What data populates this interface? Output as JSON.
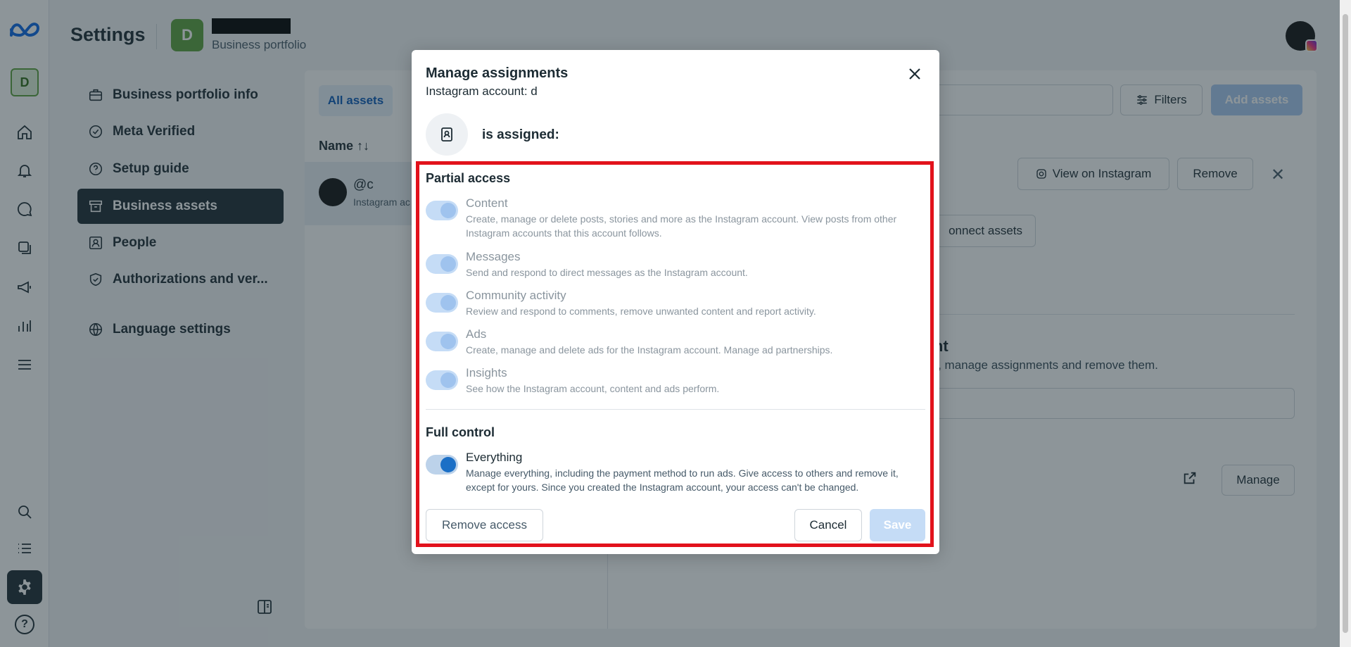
{
  "header": {
    "title": "Settings",
    "account_initial": "D",
    "account_subtitle": "Business portfolio"
  },
  "rail": {
    "account_initial": "D"
  },
  "settings_nav": [
    {
      "label": "Business portfolio info",
      "icon": "briefcase-icon"
    },
    {
      "label": "Meta Verified",
      "icon": "verified-badge-icon"
    },
    {
      "label": "Setup guide",
      "icon": "question-circle-icon"
    },
    {
      "label": "Business assets",
      "icon": "asset-box-icon",
      "active": true
    },
    {
      "label": "People",
      "icon": "people-icon"
    },
    {
      "label": "Authorizations and ver...",
      "icon": "shield-check-icon"
    },
    {
      "label": "Language settings",
      "icon": "globe-icon"
    }
  ],
  "assets": {
    "tab_all": "All assets",
    "filters_label": "Filters",
    "add_assets_label": "Add assets",
    "column_name": "Name ↑↓",
    "row_handle": "@c",
    "row_sub": "Instagram ac"
  },
  "detail": {
    "view_on_instagram": "View on Instagram",
    "remove_label": "Remove",
    "connect_assets": "onnect assets",
    "section_title": "ount",
    "section_desc": "ount, manage assignments and remove them.",
    "manage_label": "Manage"
  },
  "modal": {
    "title": "Manage assignments",
    "subtitle": "Instagram account: d",
    "assigned_text": "is assigned:",
    "partial_access_title": "Partial access",
    "partial_permissions": [
      {
        "label": "Content",
        "description": "Create, manage or delete posts, stories and more as the Instagram account. View posts from other Instagram accounts that this account follows."
      },
      {
        "label": "Messages",
        "description": "Send and respond to direct messages as the Instagram account."
      },
      {
        "label": "Community activity",
        "description": "Review and respond to comments, remove unwanted content and report activity."
      },
      {
        "label": "Ads",
        "description": "Create, manage and delete ads for the Instagram account. Manage ad partnerships."
      },
      {
        "label": "Insights",
        "description": "See how the Instagram account, content and ads perform."
      }
    ],
    "full_control_title": "Full control",
    "full_permission": {
      "label": "Everything",
      "description": "Manage everything, including the payment method to run ads. Give access to others and remove it, except for yours. Since you created the Instagram account, your access can't be changed.",
      "enabled": true
    },
    "remove_access_label": "Remove access",
    "cancel_label": "Cancel",
    "save_label": "Save"
  },
  "colors": {
    "primary": "#1b6fc6",
    "highlight": "#e2121c",
    "dark": "#1c2b33"
  }
}
